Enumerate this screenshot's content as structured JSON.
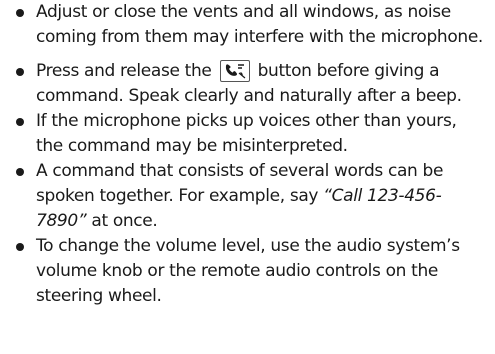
{
  "items": [
    {
      "text": "Adjust or close the vents and all windows, as noise coming from them may interfere with the microphone."
    },
    {
      "before": "Press and release the ",
      "icon": "talk-button-icon",
      "after": " button before giving a command. Speak clearly and naturally after a beep."
    },
    {
      "text": "If the microphone picks up voices other than yours, the command may be misinterpreted."
    },
    {
      "before": "A command that consists of several words can be spoken together. For example, say ",
      "quote": "“Call 123-456-7890”",
      "after": " at once."
    },
    {
      "text": "To change the volume level, use the audio system’s volume knob or the remote audio controls on the steering wheel."
    }
  ]
}
